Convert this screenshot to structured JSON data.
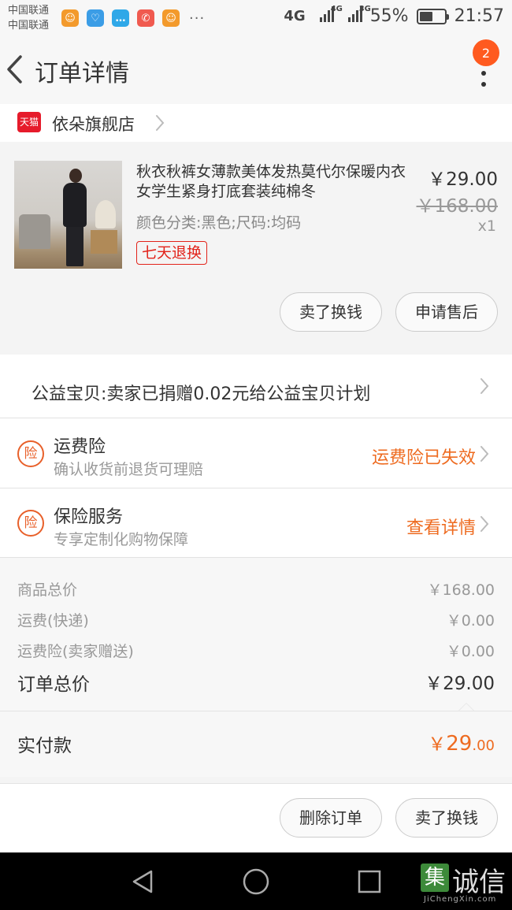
{
  "status_bar": {
    "carrier_1": "中国联通",
    "carrier_2": "中国联通",
    "more": "···",
    "network_1": "4G",
    "network_2": "4G",
    "network_3": "3G",
    "battery": "55%",
    "battery_level": 0.55,
    "time": "21:57",
    "notification_icons": [
      "uc-browser-icon",
      "health-icon",
      "message-icon",
      "missed-call-icon",
      "uc-browser-icon"
    ]
  },
  "nav": {
    "title": "订单详情",
    "badge": "2",
    "back_icon": "chevron-left-icon",
    "menu_icon": "more-vertical-icon"
  },
  "shop": {
    "logo": "天猫",
    "name": "依朵旗舰店"
  },
  "product": {
    "title": "秋衣秋裤女薄款美体发热莫代尔保暖内衣女学生紧身打底套装纯棉冬",
    "spec": "颜色分类:黑色;尺码:均码",
    "tag": "七天退换",
    "price": "￥29.00",
    "original_price": "￥168.00",
    "quantity": "x1",
    "resell_button": "卖了换钱",
    "aftersale_button": "申请售后"
  },
  "charity": {
    "text": "公益宝贝:卖家已捐赠0.02元给公益宝贝计划"
  },
  "insurance": [
    {
      "icon": "险",
      "title": "运费险",
      "subtitle": "确认收货前退货可理赔",
      "status": "运费险已失效"
    },
    {
      "icon": "险",
      "title": "保险服务",
      "subtitle": "专享定制化购物保障",
      "status": "查看详情"
    }
  ],
  "summary": {
    "items": [
      {
        "label": "商品总价",
        "value": "￥168.00"
      },
      {
        "label": "运费(快递)",
        "value": "￥0.00"
      },
      {
        "label": "运费险(卖家赠送)",
        "value": "￥0.00"
      }
    ],
    "total_label": "订单总价",
    "total_value": "￥29.00",
    "paid_label": "实付款",
    "paid_currency": "￥",
    "paid_integer": "29",
    "paid_decimal": ".00"
  },
  "actions": {
    "delete_order": "删除订单",
    "resell": "卖了换钱"
  },
  "watermark": {
    "logo": "集",
    "text": "诚信",
    "url": "JiChengXin.com"
  },
  "colors": {
    "accent": "#ee6b20",
    "tmall_red": "#e61b2b",
    "tag_red": "#e2231a",
    "badge": "#ff5a1f"
  }
}
